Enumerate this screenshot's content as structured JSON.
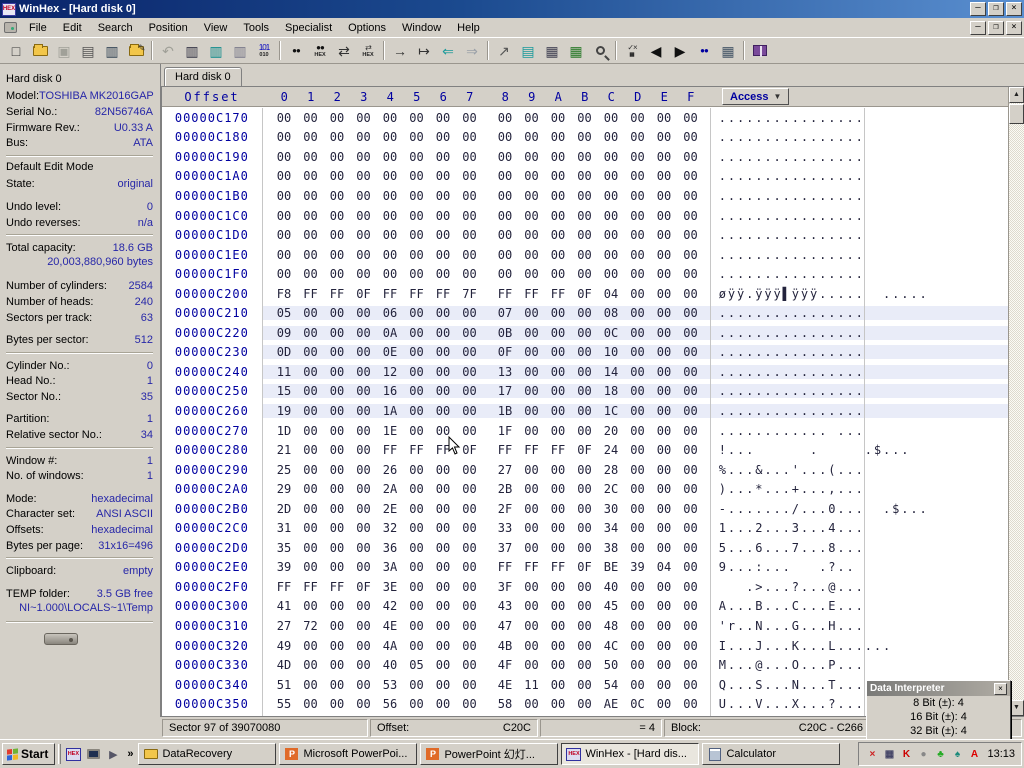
{
  "window": {
    "title": "WinHex - [Hard disk 0]",
    "app_icon": "HEX"
  },
  "menu": {
    "items": [
      "File",
      "Edit",
      "Search",
      "Position",
      "View",
      "Tools",
      "Specialist",
      "Options",
      "Window",
      "Help"
    ]
  },
  "toolbar": {
    "groups": [
      [
        "new-file",
        "open-file",
        "save",
        "print",
        "properties",
        "edit-folder"
      ],
      [
        "undo",
        "copy",
        "paste-clipboard",
        "paste-into",
        "binary-convert"
      ],
      [
        "find-text",
        "find-hex",
        "replace-text",
        "replace-hex"
      ],
      [
        "goto-offset",
        "goto-block",
        "back",
        "forward"
      ],
      [
        "send-to",
        "open-disk",
        "open-ram",
        "position-manager",
        "magnifier"
      ],
      [
        "calculator",
        "prev-position",
        "next-position",
        "find-next",
        "records-view"
      ],
      [
        "help-manual"
      ]
    ]
  },
  "sidebar": {
    "rows": [
      {
        "type": "title",
        "label": "Hard disk 0"
      },
      {
        "type": "pair",
        "label": "Model:",
        "value": "TOSHIBA MK2016GAP"
      },
      {
        "type": "pair",
        "label": "Serial No.:",
        "value": "82N56746A"
      },
      {
        "type": "pair",
        "label": "Firmware Rev.:",
        "value": "U0.33 A"
      },
      {
        "type": "pair",
        "label": "Bus:",
        "value": "ATA"
      },
      {
        "type": "divider"
      },
      {
        "type": "title",
        "label": "Default Edit Mode"
      },
      {
        "type": "pair",
        "label": "State:",
        "value": "original"
      },
      {
        "type": "gap"
      },
      {
        "type": "pair",
        "label": "Undo level:",
        "value": "0"
      },
      {
        "type": "pair",
        "label": "Undo reverses:",
        "value": "n/a"
      },
      {
        "type": "divider"
      },
      {
        "type": "pair",
        "label": "Total capacity:",
        "value": "18.6 GB"
      },
      {
        "type": "note",
        "label": "20,003,880,960 bytes"
      },
      {
        "type": "gap"
      },
      {
        "type": "pair",
        "label": "Number of cylinders:",
        "value": "2584"
      },
      {
        "type": "pair",
        "label": "Number of heads:",
        "value": "240"
      },
      {
        "type": "pair",
        "label": "Sectors per track:",
        "value": "63"
      },
      {
        "type": "gap"
      },
      {
        "type": "pair",
        "label": "Bytes per sector:",
        "value": "512"
      },
      {
        "type": "divider"
      },
      {
        "type": "pair",
        "label": "Cylinder No.:",
        "value": "0"
      },
      {
        "type": "pair",
        "label": "Head No.:",
        "value": "1"
      },
      {
        "type": "pair",
        "label": "Sector No.:",
        "value": "35"
      },
      {
        "type": "gap"
      },
      {
        "type": "pair",
        "label": "Partition:",
        "value": "1"
      },
      {
        "type": "pair",
        "label": "Relative sector No.:",
        "value": "34"
      },
      {
        "type": "divider"
      },
      {
        "type": "pair",
        "label": "Window #:",
        "value": "1"
      },
      {
        "type": "pair",
        "label": "No. of windows:",
        "value": "1"
      },
      {
        "type": "gap"
      },
      {
        "type": "pair",
        "label": "Mode:",
        "value": "hexadecimal"
      },
      {
        "type": "pair",
        "label": "Character set:",
        "value": "ANSI ASCII"
      },
      {
        "type": "pair",
        "label": "Offsets:",
        "value": "hexadecimal"
      },
      {
        "type": "pair",
        "label": "Bytes per page:",
        "value": "31x16=496"
      },
      {
        "type": "divider"
      },
      {
        "type": "pair",
        "label": "Clipboard:",
        "value": "empty"
      },
      {
        "type": "gap"
      },
      {
        "type": "pair",
        "label": "TEMP folder:",
        "value": "3.5 GB free"
      },
      {
        "type": "note",
        "label": "NI~1.000\\LOCALS~1\\Temp"
      },
      {
        "type": "divider"
      }
    ]
  },
  "tab": {
    "label": "Hard disk 0"
  },
  "hex_view": {
    "header": {
      "offset_label": "Offset",
      "columns": [
        "0",
        "1",
        "2",
        "3",
        "4",
        "5",
        "6",
        "7",
        "8",
        "9",
        "A",
        "B",
        "C",
        "D",
        "E",
        "F"
      ],
      "access_label": "Access",
      "access_arrow": "▼"
    },
    "rows": [
      {
        "offset": "00000C170",
        "bytes": "00 00 00 00 00 00 00 00 00 00 00 00 00 00 00 00",
        "ascii": "................",
        "selected": false
      },
      {
        "offset": "00000C180",
        "bytes": "00 00 00 00 00 00 00 00 00 00 00 00 00 00 00 00",
        "ascii": "................",
        "selected": false
      },
      {
        "offset": "00000C190",
        "bytes": "00 00 00 00 00 00 00 00 00 00 00 00 00 00 00 00",
        "ascii": "................",
        "selected": false
      },
      {
        "offset": "00000C1A0",
        "bytes": "00 00 00 00 00 00 00 00 00 00 00 00 00 00 00 00",
        "ascii": "................",
        "selected": false
      },
      {
        "offset": "00000C1B0",
        "bytes": "00 00 00 00 00 00 00 00 00 00 00 00 00 00 00 00",
        "ascii": "................",
        "selected": false
      },
      {
        "offset": "00000C1C0",
        "bytes": "00 00 00 00 00 00 00 00 00 00 00 00 00 00 00 00",
        "ascii": "................",
        "selected": false
      },
      {
        "offset": "00000C1D0",
        "bytes": "00 00 00 00 00 00 00 00 00 00 00 00 00 00 00 00",
        "ascii": "................",
        "selected": false
      },
      {
        "offset": "00000C1E0",
        "bytes": "00 00 00 00 00 00 00 00 00 00 00 00 00 00 00 00",
        "ascii": "................",
        "selected": false
      },
      {
        "offset": "00000C1F0",
        "bytes": "00 00 00 00 00 00 00 00 00 00 00 00 00 00 00 00",
        "ascii": "................",
        "selected": false
      },
      {
        "offset": "00000C200",
        "bytes": "F8 FF FF 0F FF FF FF 7F FF FF FF 0F 04 00 00 00",
        "ascii": "øÿÿ.ÿÿÿ▌ÿÿÿ.....  .....",
        "selected": false
      },
      {
        "offset": "00000C210",
        "bytes": "05 00 00 00 06 00 00 00 07 00 00 00 08 00 00 00",
        "ascii": "................",
        "selected": true
      },
      {
        "offset": "00000C220",
        "bytes": "09 00 00 00 0A 00 00 00 0B 00 00 00 0C 00 00 00",
        "ascii": "................",
        "selected": true
      },
      {
        "offset": "00000C230",
        "bytes": "0D 00 00 00 0E 00 00 00 0F 00 00 00 10 00 00 00",
        "ascii": "................",
        "selected": true
      },
      {
        "offset": "00000C240",
        "bytes": "11 00 00 00 12 00 00 00 13 00 00 00 14 00 00 00",
        "ascii": "................",
        "selected": true
      },
      {
        "offset": "00000C250",
        "bytes": "15 00 00 00 16 00 00 00 17 00 00 00 18 00 00 00",
        "ascii": "................",
        "selected": true
      },
      {
        "offset": "00000C260",
        "bytes": "19 00 00 00 1A 00 00 00 1B 00 00 00 1C 00 00 00",
        "ascii": "................",
        "selected": true
      },
      {
        "offset": "00000C270",
        "bytes": "1D 00 00 00 1E 00 00 00 1F 00 00 00 20 00 00 00",
        "ascii": "............ ...",
        "selected": false
      },
      {
        "offset": "00000C280",
        "bytes": "21 00 00 00 FF FF FF 0F FF FF FF 0F 24 00 00 00",
        "ascii": "!...      .     .$...",
        "selected": false
      },
      {
        "offset": "00000C290",
        "bytes": "25 00 00 00 26 00 00 00 27 00 00 00 28 00 00 00",
        "ascii": "%...&...'...(...",
        "selected": false
      },
      {
        "offset": "00000C2A0",
        "bytes": "29 00 00 00 2A 00 00 00 2B 00 00 00 2C 00 00 00",
        "ascii": ")...*...+...,...",
        "selected": false
      },
      {
        "offset": "00000C2B0",
        "bytes": "2D 00 00 00 2E 00 00 00 2F 00 00 00 30 00 00 00",
        "ascii": "-......./...0...  .$...",
        "selected": false
      },
      {
        "offset": "00000C2C0",
        "bytes": "31 00 00 00 32 00 00 00 33 00 00 00 34 00 00 00",
        "ascii": "1...2...3...4...",
        "selected": false
      },
      {
        "offset": "00000C2D0",
        "bytes": "35 00 00 00 36 00 00 00 37 00 00 00 38 00 00 00",
        "ascii": "5...6...7...8...",
        "selected": false
      },
      {
        "offset": "00000C2E0",
        "bytes": "39 00 00 00 3A 00 00 00 FF FF FF 0F BE 39 04 00",
        "ascii": "9...:...   .?..",
        "selected": false
      },
      {
        "offset": "00000C2F0",
        "bytes": "FF FF FF 0F 3E 00 00 00 3F 00 00 00 40 00 00 00",
        "ascii": "   .>...?...@...",
        "selected": false
      },
      {
        "offset": "00000C300",
        "bytes": "41 00 00 00 42 00 00 00 43 00 00 00 45 00 00 00",
        "ascii": "A...B...C...E...",
        "selected": false
      },
      {
        "offset": "00000C310",
        "bytes": "27 72 00 00 4E 00 00 00 47 00 00 00 48 00 00 00",
        "ascii": "'r..N...G...H...",
        "selected": false
      },
      {
        "offset": "00000C320",
        "bytes": "49 00 00 00 4A 00 00 00 4B 00 00 00 4C 00 00 00",
        "ascii": "I...J...K...L......",
        "selected": false
      },
      {
        "offset": "00000C330",
        "bytes": "4D 00 00 00 40 05 00 00 4F 00 00 00 50 00 00 00",
        "ascii": "M...@...O...P...",
        "selected": false
      },
      {
        "offset": "00000C340",
        "bytes": "51 00 00 00 53 00 00 00 4E 11 00 00 54 00 00 00",
        "ascii": "Q...S...N...T...",
        "selected": false
      },
      {
        "offset": "00000C350",
        "bytes": "55 00 00 00 56 00 00 00 58 00 00 00 AE 0C 00 00",
        "ascii": "U...V...X...?...",
        "selected": false
      }
    ]
  },
  "status_bar": {
    "sector": "Sector 97 of 39070080",
    "offset_label": "Offset:",
    "offset_value": "C20C",
    "equals": "= 4",
    "block_label": "Block:",
    "block_value": "C20C - C266"
  },
  "data_interpreter": {
    "title": "Data Interpreter",
    "close": "×",
    "rows": [
      "8 Bit (±): 4",
      "16 Bit (±): 4",
      "32 Bit (±): 4"
    ]
  },
  "taskbar": {
    "start_label": "Start",
    "overflow_chevron": "»",
    "quick_launch": [
      "winhex",
      "desktop",
      "media"
    ],
    "tasks": [
      {
        "label": "DataRecovery",
        "icon": "folder",
        "active": false
      },
      {
        "label": "Microsoft PowerPoi...",
        "icon": "powerpoint",
        "active": false
      },
      {
        "label": "PowerPoint 幻灯...",
        "icon": "powerpoint",
        "active": false
      },
      {
        "label": "WinHex - [Hard dis...",
        "icon": "winhex",
        "active": true
      },
      {
        "label": "Calculator",
        "icon": "calculator",
        "active": false
      }
    ],
    "tray_icons": [
      "x-red",
      "monitor",
      "k-red",
      "dot-gray",
      "leaf-green",
      "plant-teal",
      "ati-red"
    ],
    "clock": "13:13"
  },
  "colors": {
    "window_bg": "#d4d0c8",
    "titlebar_start": "#0a246a",
    "titlebar_end": "#5a8fd0",
    "offset_text": "#0000a0",
    "hex_text": "#23233c",
    "sidebar_value": "#2727a8",
    "selection_tint": "#e9ecf8"
  },
  "caption_buttons": {
    "minimize": "—",
    "restore": "❐",
    "close": "×"
  }
}
